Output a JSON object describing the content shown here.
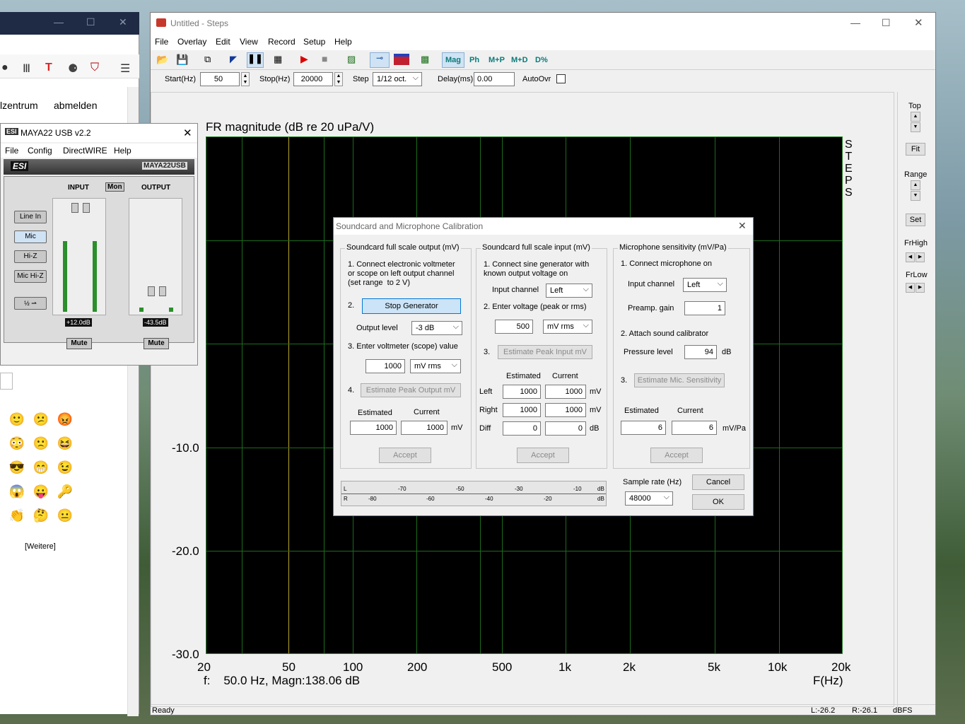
{
  "browser": {
    "menu_close": "✕",
    "menu_restore": "☐",
    "menu_min": "—",
    "nav_partial": "lzentrum",
    "nav_logout": "abmelden",
    "more_link": "[Weitere]",
    "toolbar_icons": [
      "account-icon",
      "library-icon",
      "text-icon",
      "extension-icon",
      "shield-icon",
      "menu-icon"
    ]
  },
  "maya": {
    "title": "MAYA22 USB v2.2",
    "menu": [
      "File",
      "Config",
      "DirectWIRE",
      "Help"
    ],
    "brand": "ESI",
    "brand_right": "MAYA22USB",
    "input_label": "INPUT",
    "mon_label": "Mon",
    "output_label": "OUTPUT",
    "buttons": [
      "Line In",
      "Mic",
      "Hi-Z",
      "Mic Hi-Z"
    ],
    "input_level": "+12.0dB",
    "output_level": "-43.5dB",
    "mute": "Mute"
  },
  "steps": {
    "title": "Untitled - Steps",
    "menu": [
      "File",
      "Overlay",
      "Edit",
      "View",
      "Record",
      "Setup",
      "Help"
    ],
    "toolbar_text": [
      "Mag",
      "Ph",
      "M+P",
      "M+D",
      "D%"
    ],
    "params": {
      "start_label": "Start(Hz)",
      "start": "50",
      "stop_label": "Stop(Hz)",
      "stop": "20000",
      "step_label": "Step",
      "step": "1/12 oct.",
      "delay_label": "Delay(ms)",
      "delay": "0.00",
      "autoovr_label": "AutoOvr"
    },
    "plot_title": "FR magnitude (dB re 20 uPa/V)",
    "brand_vertical": [
      "S",
      "T",
      "E",
      "P",
      "S"
    ],
    "y_ticks": [
      "-10.0",
      "-20.0",
      "-30.0"
    ],
    "x_ticks": [
      "20",
      "50",
      "100",
      "200",
      "500",
      "1k",
      "2k",
      "5k",
      "10k",
      "20k"
    ],
    "cursor_readout": "f:    50.0 Hz, Magn:138.06 dB",
    "x_axis": "F(Hz)",
    "right_panel": {
      "top": "Top",
      "fit": "Fit",
      "range": "Range",
      "set": "Set",
      "frhigh": "FrHigh",
      "frlow": "FrLow"
    },
    "status": {
      "ready": "Ready",
      "left": "L:-26.2",
      "right": "R:-26.1",
      "unit": "dBFS"
    }
  },
  "dialog": {
    "title": "Soundcard and Microphone Calibration",
    "output_group": {
      "title": "Soundcard full scale output (mV)",
      "step1": "1. Connect electronic voltmeter\nor scope on left output channel\n(set range  to 2 V)",
      "step2": "2.",
      "stop_generator": "Stop Generator",
      "output_level_label": "Output level",
      "output_level": "-3 dB",
      "step3": "3. Enter voltmeter (scope) value",
      "volt_value": "1000",
      "volt_unit": "mV rms",
      "step4": "4.",
      "estimate_btn": "Estimate Peak Output mV",
      "estimated_label": "Estimated",
      "current_label": "Current",
      "estimated": "1000",
      "current": "1000",
      "unit": "mV",
      "accept": "Accept"
    },
    "input_group": {
      "title": "Soundcard full scale  input (mV)",
      "step1": "1. Connect sine generator with\nknown output voltage on",
      "input_channel_label": "Input channel",
      "input_channel": "Left",
      "step2": "2. Enter voltage (peak or rms)",
      "voltage": "500",
      "voltage_unit": "mV rms",
      "step3": "3.",
      "estimate_btn": "Estimate Peak Input mV",
      "estimated_label": "Estimated",
      "current_label": "Current",
      "rows": [
        {
          "label": "Left",
          "estimated": "1000",
          "current": "1000",
          "unit": "mV"
        },
        {
          "label": "Right",
          "estimated": "1000",
          "current": "1000",
          "unit": "mV"
        },
        {
          "label": "Diff",
          "estimated": "0",
          "current": "0",
          "unit": "dB"
        }
      ],
      "accept": "Accept"
    },
    "mic_group": {
      "title": "Microphone sensitivity (mV/Pa)",
      "step1": "1. Connect microphone on",
      "input_channel_label": "Input channel",
      "input_channel": "Left",
      "preamp_label": "Preamp. gain",
      "preamp": "1",
      "step2": "2. Attach sound calibrator",
      "pressure_label": "Pressure level",
      "pressure": "94",
      "pressure_unit": "dB",
      "step3": "3.",
      "estimate_btn": "Estimate Mic. Sensitivity",
      "estimated_label": "Estimated",
      "current_label": "Current",
      "estimated": "6",
      "current": "6",
      "unit": "mV/Pa",
      "accept": "Accept"
    },
    "meter": {
      "row_l": "L",
      "row_r": "R",
      "unit": "dB",
      "l_ticks": [
        "-70",
        "-50",
        "-30",
        "-10"
      ],
      "r_ticks": [
        "-80",
        "-60",
        "-40",
        "-20"
      ]
    },
    "sample_rate_label": "Sample rate (Hz)",
    "sample_rate": "48000",
    "cancel": "Cancel",
    "ok": "OK"
  }
}
